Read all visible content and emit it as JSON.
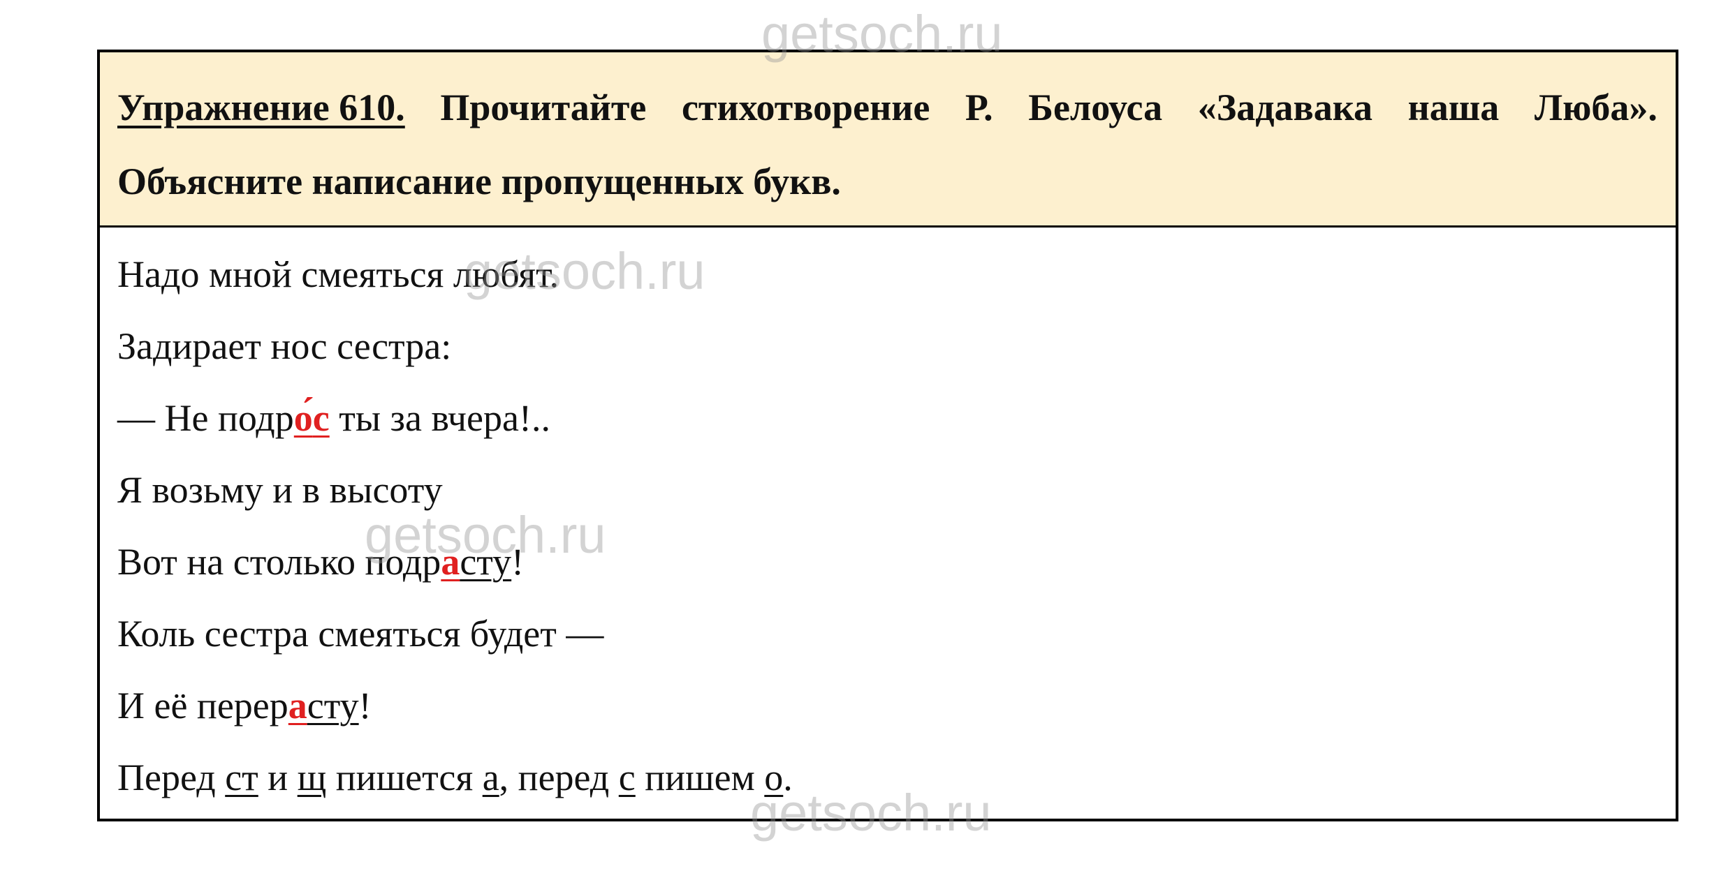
{
  "watermark": "getsoch.ru",
  "exercise": {
    "number_label": "Упражнение 610.",
    "instruction_words": [
      "Прочитайте",
      "стихотворение",
      "Р.",
      "Белоуса",
      "«Задавака",
      "наша",
      "Люба»."
    ],
    "instruction_line2": "Объясните написание пропущенных букв."
  },
  "poem": {
    "line1": "Надо мной смеяться любят.",
    "line2": "Задирает нос сестра:",
    "line3": {
      "a": "— Не подр",
      "letter": "о́",
      "b": "с",
      "c": " ты за вчера!.."
    },
    "line4": "Я возьму и в высоту",
    "line5": {
      "a": "Вот на столько подр",
      "letter": "а",
      "b": "сту",
      "c": "!"
    },
    "line6": "Коль сестра смеяться будет —",
    "line7": {
      "a": "И её перер",
      "letter": "а",
      "b": "сту",
      "c": "!"
    }
  },
  "rule": {
    "p1": "Перед ",
    "u1": "ст",
    "p2": " и ",
    "u2": "щ",
    "p3": " пишется ",
    "u3": "а",
    "p4": ", перед ",
    "u4": "с",
    "p5": " пишем ",
    "u5": "о",
    "p6": "."
  },
  "colors": {
    "header_bg": "#fdf0cf",
    "highlight_red": "#e02020",
    "border": "#000000"
  }
}
